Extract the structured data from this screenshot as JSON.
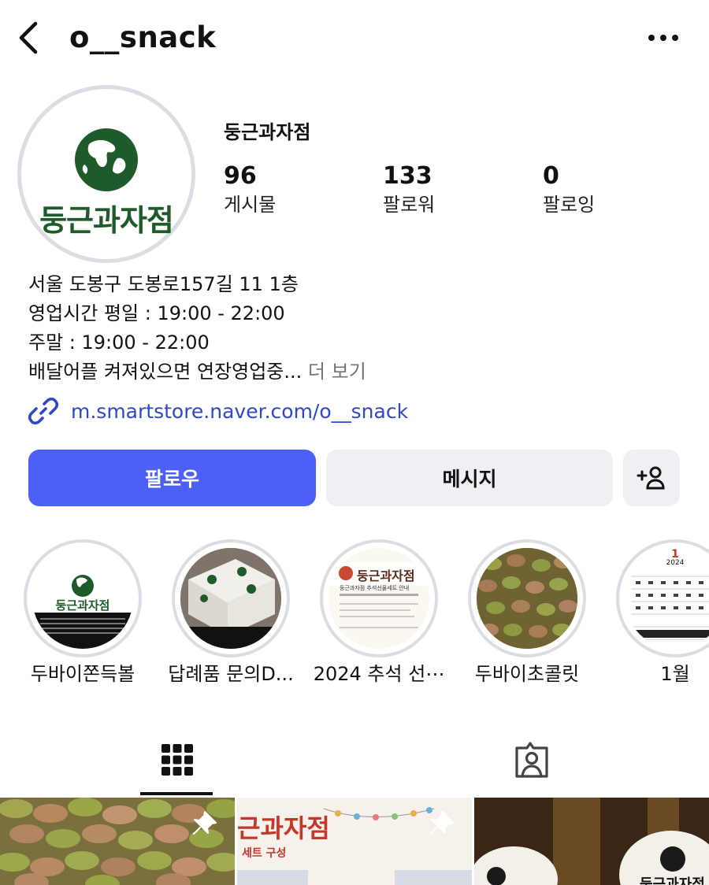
{
  "header": {
    "username": "o__snack",
    "back_icon": "chevron-left-icon",
    "more_icon": "ellipsis-icon"
  },
  "profile": {
    "avatar_text": "둥근과자점",
    "display_name": "둥근과자점",
    "stats": [
      {
        "value": "96",
        "label": "게시물"
      },
      {
        "value": "133",
        "label": "팔로워"
      },
      {
        "value": "0",
        "label": "팔로잉"
      }
    ],
    "bio": {
      "line1": "서울 도봉구 도봉로157길 11 1층",
      "line2": "영업시간 평일 : 19:00 - 22:00",
      "line3": "주말 : 19:00 - 22:00",
      "line4": "배달어플 켜져있으면 연장영업중...",
      "more": "더 보기"
    },
    "link": "m.smartstore.naver.com/o__snack"
  },
  "actions": {
    "follow": "팔로우",
    "message": "메시지",
    "add_user_icon": "add-person-icon"
  },
  "highlights": [
    {
      "label": "두바이쫀득볼"
    },
    {
      "label": "답례품 문의D..."
    },
    {
      "label": "2024 추석 선⋯"
    },
    {
      "label": "두바이초콜릿"
    },
    {
      "label": "1월"
    }
  ],
  "highlight_texts": {
    "h3_title": "둥근과자점",
    "h3_sub": "둥근과자점 추석선물세트 안내",
    "h5_year": "2024",
    "h5_month": "1"
  },
  "tabs": {
    "grid_icon": "grid-icon",
    "tagged_icon": "tagged-person-icon"
  },
  "posts": {
    "post2_title": "근과자점",
    "post2_sub": "세트 구성",
    "post3_text": "둥근과자점"
  },
  "colors": {
    "accent": "#4c5ff6",
    "link": "#2f47c8",
    "button_gray": "#eff0f3",
    "logo_green": "#1f5a2a"
  }
}
